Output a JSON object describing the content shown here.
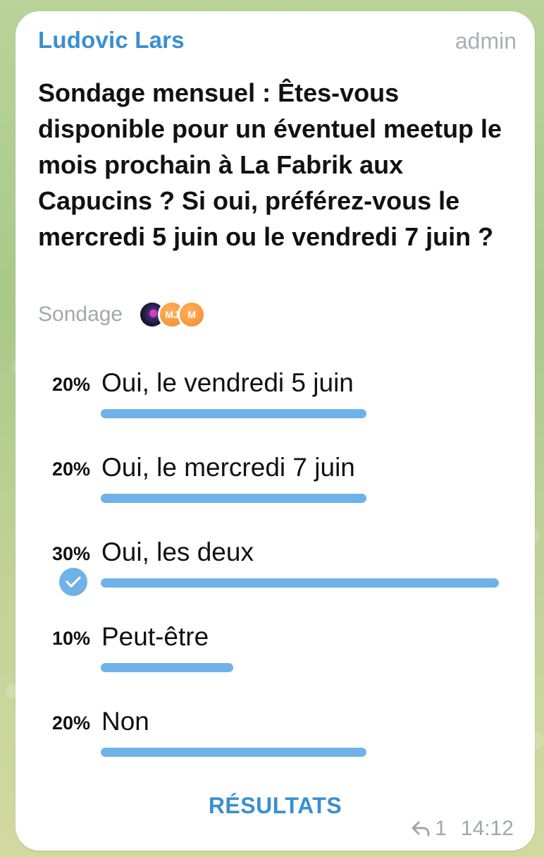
{
  "message": {
    "sender": "Ludovic Lars",
    "role": "admin",
    "reply_count": "1",
    "time": "14:12"
  },
  "poll": {
    "question": "Sondage mensuel : Êtes-vous disponible pour un éventuel meetup le mois prochain à La Fabrik aux Capucins ? Si oui, préférez-vous le mercredi 5 juin ou le vendredi 7 juin ?",
    "type_label": "Sondage",
    "voters": [
      {
        "initials": "",
        "style": "image"
      },
      {
        "initials": "MJ",
        "style": "orange"
      },
      {
        "initials": "M",
        "style": "orange"
      }
    ],
    "options": [
      {
        "percent": "20%",
        "value": 20,
        "label": "Oui, le vendredi 5 juin",
        "chosen": false
      },
      {
        "percent": "20%",
        "value": 20,
        "label": "Oui, le mercredi 7 juin",
        "chosen": false
      },
      {
        "percent": "30%",
        "value": 30,
        "label": "Oui, les deux",
        "chosen": true
      },
      {
        "percent": "10%",
        "value": 10,
        "label": "Peut-être",
        "chosen": false
      },
      {
        "percent": "20%",
        "value": 20,
        "label": "Non",
        "chosen": false
      }
    ],
    "results_label": "RÉSULTATS"
  },
  "colors": {
    "accent": "#3a8fd0",
    "bar": "#6fb2e8",
    "muted": "#a3a8ad",
    "text": "#111111"
  },
  "icons": {
    "check": "check-circle-icon",
    "reply": "reply-arrow-icon"
  }
}
